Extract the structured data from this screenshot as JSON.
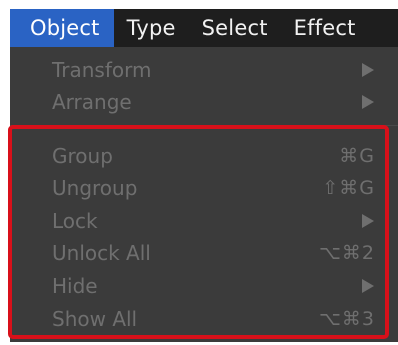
{
  "menubar": {
    "items": [
      {
        "label": "Object",
        "active": true
      },
      {
        "label": "Type",
        "active": false
      },
      {
        "label": "Select",
        "active": false
      },
      {
        "label": "Effect",
        "active": false
      }
    ]
  },
  "menu": {
    "transform": {
      "label": "Transform",
      "submenu": true
    },
    "arrange": {
      "label": "Arrange",
      "submenu": true
    },
    "group": {
      "label": "Group",
      "shortcut": "⌘G"
    },
    "ungroup": {
      "label": "Ungroup",
      "shortcut": "⇧⌘G"
    },
    "lock": {
      "label": "Lock",
      "submenu": true
    },
    "unlock_all": {
      "label": "Unlock All",
      "shortcut": "⌥⌘2"
    },
    "hide": {
      "label": "Hide",
      "submenu": true
    },
    "show_all": {
      "label": "Show All",
      "shortcut": "⌥⌘3"
    }
  },
  "colors": {
    "menubar_bg": "#1e1e1e",
    "active_menu_bg": "#2a63c4",
    "dropdown_bg": "#3b3b3b",
    "disabled_text": "#6f6f6f",
    "highlight_border": "#d8101a"
  },
  "icons": {
    "submenu": "submenu-arrow-icon"
  }
}
